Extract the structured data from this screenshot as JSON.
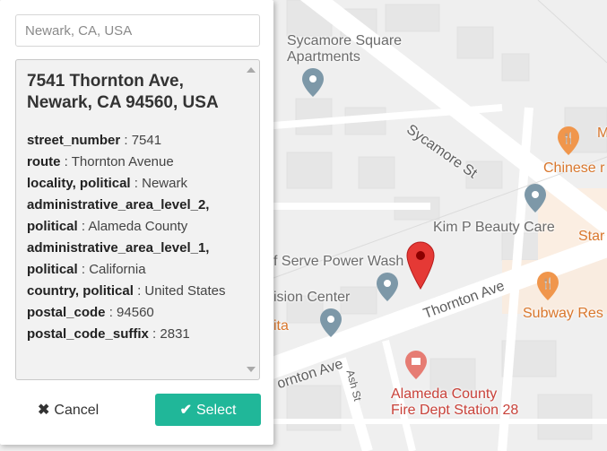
{
  "search": {
    "placeholder": "Newark, CA, USA"
  },
  "details": {
    "title_line1": "7541 Thornton Ave,",
    "title_line2": "Newark, CA 94560, USA",
    "rows": [
      {
        "key": "street_number",
        "value": "7541"
      },
      {
        "key": "route",
        "value": "Thornton Avenue"
      },
      {
        "key": "locality, political",
        "value": "Newark"
      },
      {
        "key": "administrative_area_level_2, political",
        "value": "Alameda County"
      },
      {
        "key": "administrative_area_level_1, political",
        "value": "California"
      },
      {
        "key": "country, political",
        "value": "United States"
      },
      {
        "key": "postal_code",
        "value": "94560"
      },
      {
        "key": "postal_code_suffix",
        "value": "2831"
      }
    ]
  },
  "buttons": {
    "cancel_label": "Cancel",
    "cancel_icon": "✖",
    "select_label": "Select",
    "select_icon": "✔"
  },
  "map": {
    "labels": {
      "sycamore_apts_1": "Sycamore Square",
      "sycamore_apts_2": "Apartments",
      "sycamore_st": "Sycamore St",
      "chinese": "Chinese r",
      "m_fragment": "M",
      "kim_beauty": "Kim P Beauty Care",
      "star_fragment": "Star",
      "self_serve": "f Serve Power Wash",
      "vision_center": "ision Center",
      "thornton_ave_right": "Thornton Ave",
      "thornton_ave_left": "ornton Ave",
      "subway": "Subway Res",
      "ita_fragment": "ita",
      "ash_st": "Ash St",
      "fire_station_1": "Alameda County",
      "fire_station_2": "Fire Dept Station 28"
    },
    "colors": {
      "background": "#efefef",
      "road": "#ffffff",
      "poi_gray": "#7d98a8",
      "poi_orange": "#f0964c",
      "poi_red": "#e67c73",
      "marker": "#e53935",
      "accent": "#20b799"
    }
  }
}
